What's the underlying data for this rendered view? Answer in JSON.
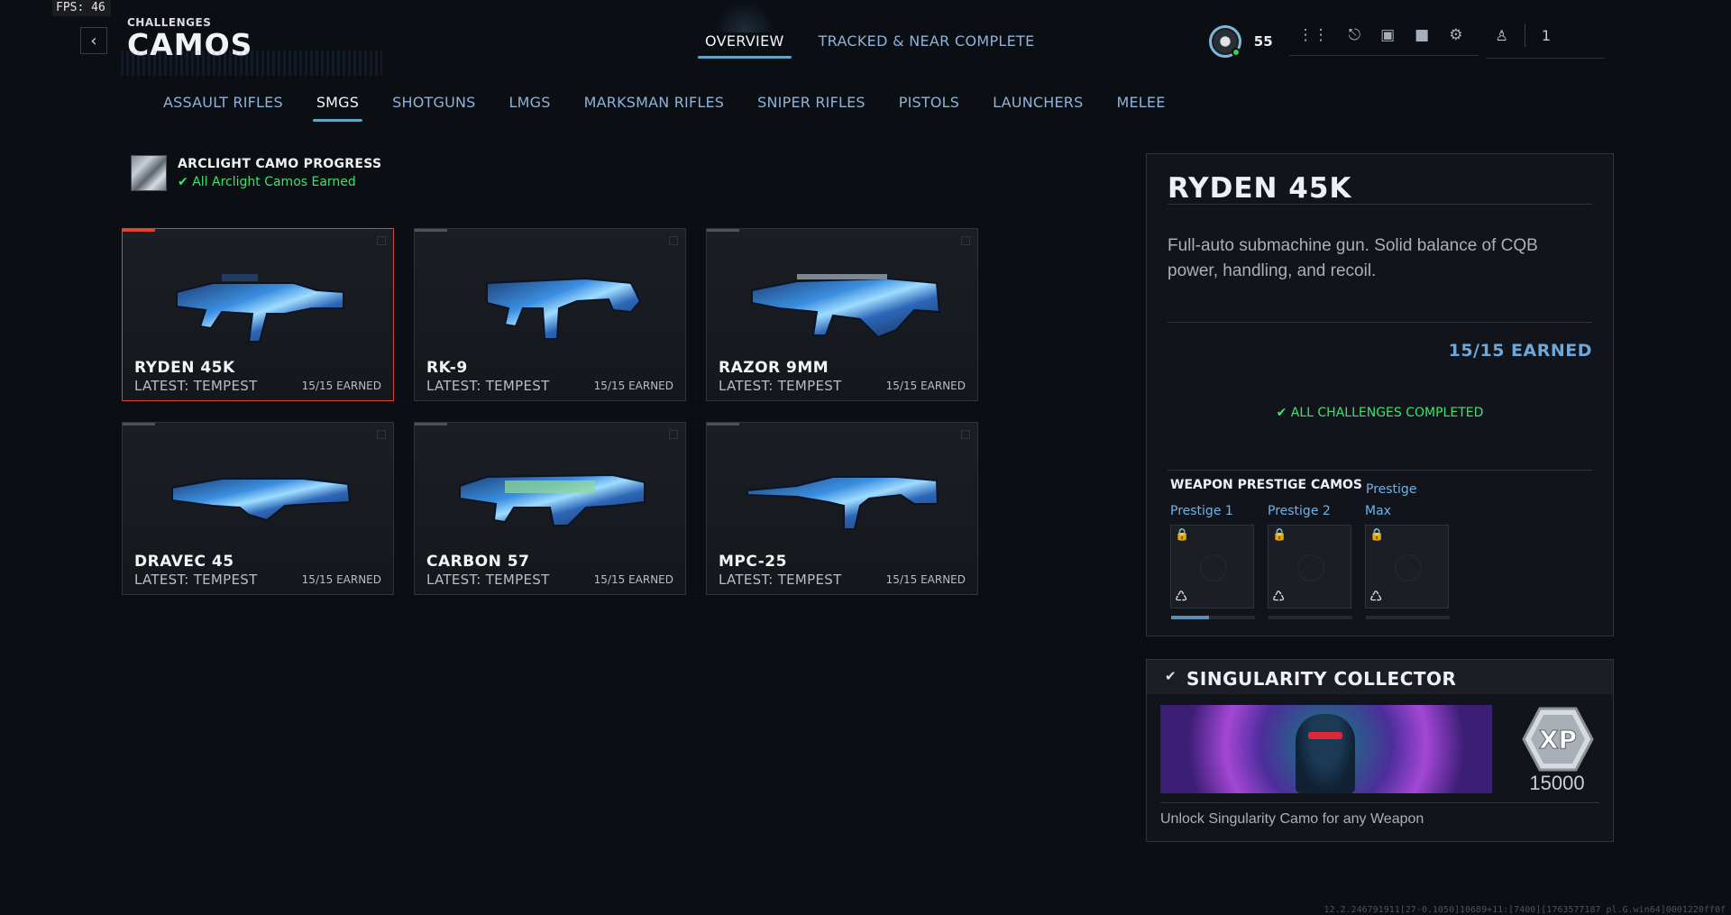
{
  "fps": "FPS:  46",
  "header": {
    "small_title": "CHALLENGES",
    "big_title": "CAMOS"
  },
  "top_tabs": [
    {
      "label": "OVERVIEW",
      "active": true
    },
    {
      "label": "TRACKED & NEAR COMPLETE",
      "active": false
    }
  ],
  "hud": {
    "level": "55",
    "party_count": "1"
  },
  "categories": [
    {
      "label": "ASSAULT RIFLES"
    },
    {
      "label": "SMGS",
      "active": true
    },
    {
      "label": "SHOTGUNS"
    },
    {
      "label": "LMGS"
    },
    {
      "label": "MARKSMAN RIFLES"
    },
    {
      "label": "SNIPER RIFLES"
    },
    {
      "label": "PISTOLS"
    },
    {
      "label": "LAUNCHERS"
    },
    {
      "label": "MELEE"
    }
  ],
  "arclight": {
    "title": "ARCLIGHT CAMO PROGRESS",
    "status": "All Arclight Camos Earned"
  },
  "weapons": [
    {
      "name": "RYDEN 45K",
      "latest": "LATEST: TEMPEST",
      "earned": "15/15 EARNED",
      "selected": true
    },
    {
      "name": "RK-9",
      "latest": "LATEST: TEMPEST",
      "earned": "15/15 EARNED"
    },
    {
      "name": "RAZOR 9MM",
      "latest": "LATEST: TEMPEST",
      "earned": "15/15 EARNED"
    },
    {
      "name": "DRAVEC 45",
      "latest": "LATEST: TEMPEST",
      "earned": "15/15 EARNED"
    },
    {
      "name": "CARBON 57",
      "latest": "LATEST: TEMPEST",
      "earned": "15/15 EARNED"
    },
    {
      "name": "MPC-25",
      "latest": "LATEST: TEMPEST",
      "earned": "15/15 EARNED"
    }
  ],
  "detail": {
    "name": "RYDEN 45K",
    "description": "Full-auto submachine gun. Solid balance of CQB power, handling, and recoil.",
    "earned": "15/15 EARNED",
    "status": "ALL CHALLENGES COMPLETED",
    "prestige_title": "WEAPON PRESTIGE CAMOS",
    "prestige_labels": [
      "Prestige 1",
      "Prestige 2",
      "Prestige",
      "Max"
    ]
  },
  "collector": {
    "title": "SINGULARITY COLLECTOR",
    "xp": "15000",
    "xp_badge": "XP",
    "description": "Unlock Singularity Camo for any Weapon"
  },
  "build_info": "12.2.246791911[27-0.1050]10689+11:[7400][1763577187 pl.G.win64]0001220ff0f",
  "colors": {
    "accent_blue": "#5ea6c7",
    "selected_red": "#e0432b",
    "success_green": "#3ce36f"
  },
  "icons": [
    "back-arrow-icon",
    "rank-badge-icon",
    "grid-menu-icon",
    "unlock-icon",
    "camera-icon",
    "notification-bell-icon",
    "settings-gear-icon",
    "party-icon",
    "check-icon",
    "lock-icon",
    "prestige-symbol-icon"
  ]
}
